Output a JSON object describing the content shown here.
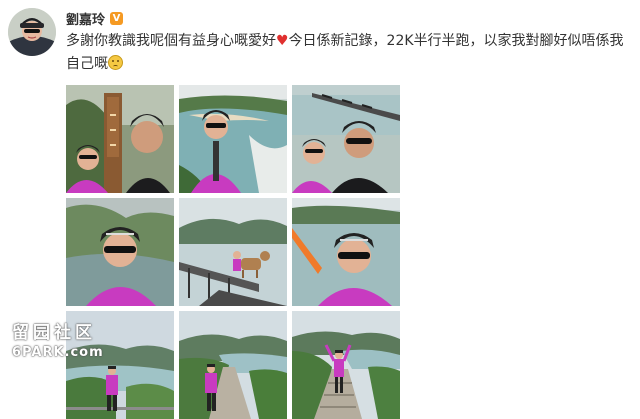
{
  "post": {
    "username": "劉嘉玲",
    "verified_badge": "V",
    "text_part1": "多謝你教識我呢個有益身心嘅愛好",
    "heart_icon": "heart-icon",
    "text_part2": "今日係新記錄，22K半行半跑，以家我對腳好似唔係我自己嘅",
    "emoji_icon": "sad-face-emoji"
  },
  "photos": [
    {
      "scene": "selfie with trail sign"
    },
    {
      "scene": "selfie above beach bay"
    },
    {
      "scene": "selfie by sea pier"
    },
    {
      "scene": "selfie before green hills"
    },
    {
      "scene": "pier with dog"
    },
    {
      "scene": "selfie raising arm by lake"
    },
    {
      "scene": "standing on coastal hill path"
    },
    {
      "scene": "walking on trail to beach"
    },
    {
      "scene": "arms raised on steps"
    }
  ],
  "watermark": {
    "line1": "留园社区",
    "line2": "6PARK.com"
  },
  "colors": {
    "text": "#333333",
    "badge": "#f59a23",
    "heart": "#e0302f"
  }
}
